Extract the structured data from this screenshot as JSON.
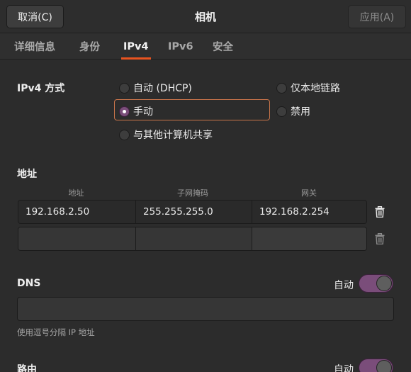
{
  "header": {
    "cancel_label": "取消(C)",
    "title": "相机",
    "apply_label": "应用(A)"
  },
  "tabs": [
    {
      "label": "详细信息",
      "active": false
    },
    {
      "label": "身份",
      "active": false
    },
    {
      "label": "IPv4",
      "active": true
    },
    {
      "label": "IPv6",
      "active": false
    },
    {
      "label": "安全",
      "active": false
    }
  ],
  "ipv4_method": {
    "label": "IPv4 方式",
    "options": [
      {
        "label": "自动 (DHCP)",
        "checked": false
      },
      {
        "label": "仅本地链路",
        "checked": false
      },
      {
        "label": "手动",
        "checked": true
      },
      {
        "label": "禁用",
        "checked": false
      },
      {
        "label": "与其他计算机共享",
        "checked": false
      }
    ]
  },
  "addresses": {
    "label": "地址",
    "columns": [
      "地址",
      "子网掩码",
      "网关"
    ],
    "rows": [
      {
        "address": "192.168.2.50",
        "netmask": "255.255.255.0",
        "gateway": "192.168.2.254"
      },
      {
        "address": "",
        "netmask": "",
        "gateway": ""
      }
    ]
  },
  "dns": {
    "label": "DNS",
    "auto_label": "自动",
    "auto_enabled": true,
    "value": "",
    "hint": "使用逗号分隔 IP 地址"
  },
  "routes": {
    "label": "路由",
    "auto_label": "自动",
    "auto_enabled": true
  },
  "colors": {
    "accent": "#e95420",
    "toggle_on": "#7a4d7a"
  }
}
